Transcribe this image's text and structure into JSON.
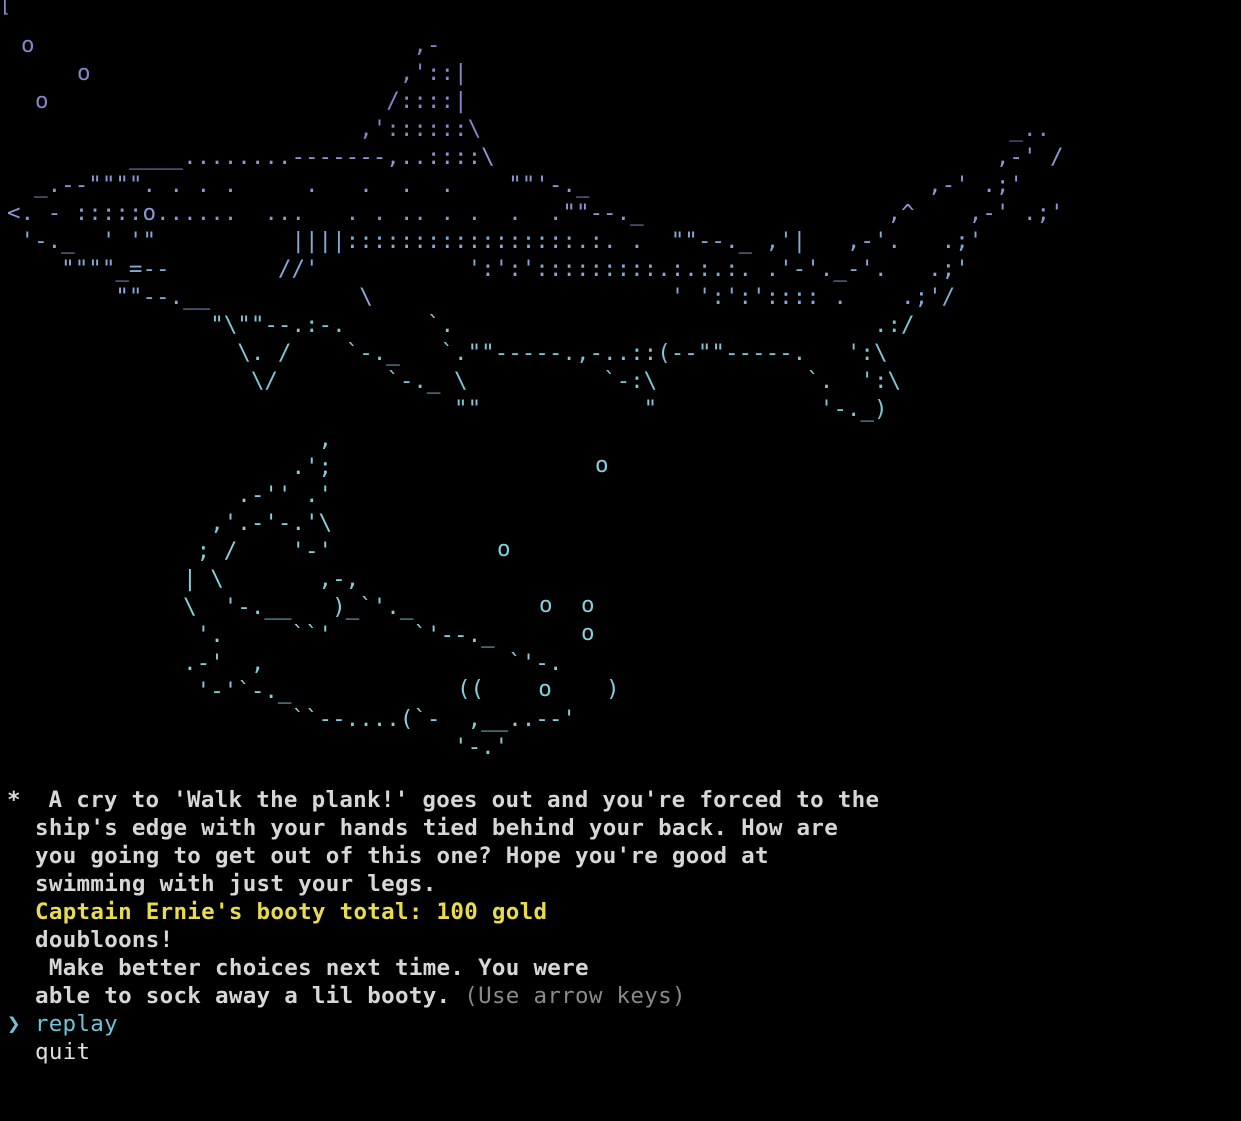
{
  "terminal": {
    "first_char": "[",
    "shark_art": [
      "                              ,-",
      "                             ,'::|",
      "                            /::::|",
      "                          ,'::::::\\                                       _..",
      "         ____........-------,..::::\\                                     ,-' /",
      "  _.--\"\"\"\". . . .     .   .  .  .    \"\"'-._                         ,-' .;'",
      "<. - :::::o......  ...   . . .. . .  .  .\"\"--._                  ,^    ,-' .;'",
      " '-._  ' '\"          ||||:::::::::::::::::.:. .  \"\"--._ ,'|   ,-'.   .;'",
      "    \"\"\"\"_=--        //'           ':':':::::::::.:.:.:. .'-'._-'.   .;'",
      "        \"\"--.__           \\                      ' ':':':::: .    .;'/",
      "               \"\\\"\"--.:-.      `.                               .:/",
      "                 \\. /    `-._   `.\"\"-----.,-..::(--\"\"-----.   ':\\",
      "                  \\/        `-._ \\          `-:\\           `.  ':\\",
      "                                 \"\"            \"            '-._)"
    ],
    "bubbles_top": [
      "o",
      "o",
      "o"
    ],
    "whale_art": [
      "                       ,",
      "                     .';",
      "                 .-'' .'",
      "               ,'.-'-.'\\",
      "              ; /    '-'",
      "             | \\       ,-,",
      "             \\  '-.__   )_`'._",
      "              '.     ``'      `'--._",
      "             .-'  ,                  `'-.",
      "              '-'`-._",
      "                     ``--....(`-  ,__..--'",
      "                                 '-.'"
    ],
    "bubbles_whale": [
      "o",
      "o",
      "o",
      "o",
      "o",
      "o"
    ],
    "whale_mouth": "((    o    )",
    "story": {
      "bullet": "*",
      "line1": "  A cry to 'Walk the plank!' goes out and you're forced to the",
      "line2": "ship's edge with your hands tied behind your back. How are",
      "line3": "you going to get out of this one? Hope you're good at",
      "line4": "swimming with just your legs.",
      "booty_line": "Captain Ernie's booty total: 100 gold",
      "booty_line2": "doubloons!",
      "line5": " Make better choices next time. You were",
      "line6": "able to sock away a lil booty.",
      "hint": "(Use arrow keys)"
    },
    "menu": {
      "pointer": "❯",
      "options": [
        "replay",
        "quit"
      ],
      "selected": "replay"
    },
    "colors": {
      "background": "#000000",
      "highlight": "#e8dc4e",
      "selected": "#6fc3d6"
    }
  }
}
